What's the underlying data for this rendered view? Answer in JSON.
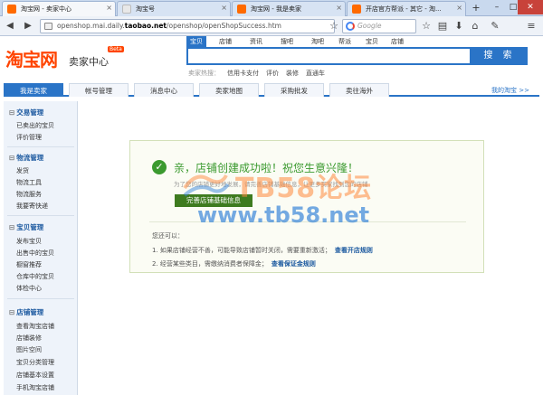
{
  "browser": {
    "tabs": [
      {
        "label": "淘宝网 - 卖家中心",
        "active": true
      },
      {
        "label": "淘宝号",
        "active": false
      },
      {
        "label": "淘宝网 - 我是卖家",
        "active": false
      },
      {
        "label": "开店官方帮派 - 其它 - 淘...",
        "active": false
      }
    ],
    "new_tab_label": "+",
    "url_prefix": "openshop.mai.daily.",
    "url_domain": "taobao.net",
    "url_suffix": "/openshop/openShopSuccess.htm",
    "search_placeholder": "Google"
  },
  "header": {
    "logo": "淘宝网",
    "logo_sub": "卖家中心",
    "badge": "Beta",
    "search_tabs": [
      "宝贝",
      "店铺",
      "资讯",
      "搜吧",
      "淘吧",
      "帮派",
      "宝贝",
      "店铺"
    ],
    "search_button": "搜 索",
    "hot_label": "卖家热搜：",
    "hot_links": [
      "信用卡支付",
      "评价",
      "装修",
      "直通车"
    ]
  },
  "mainnav": {
    "items": [
      "我是卖家",
      "帐号管理",
      "消息中心",
      "卖家地图",
      "采购批发",
      "卖往海外"
    ],
    "my_taobao": "我的淘宝 >>"
  },
  "sidebar": {
    "groups": [
      {
        "title": "交易管理",
        "items": [
          "已卖出的宝贝",
          "评价管理"
        ]
      },
      {
        "title": "物流管理",
        "items": [
          "发货",
          "物流工具",
          "物流服务",
          "我要寄快递"
        ]
      },
      {
        "title": "宝贝管理",
        "items": [
          "发布宝贝",
          "出售中的宝贝",
          "橱窗推荐",
          "仓库中的宝贝",
          "体检中心"
        ]
      },
      {
        "title": "店铺管理",
        "items": [
          "查看淘宝店铺",
          "店铺装修",
          "图片空间",
          "宝贝分类管理",
          "店铺基本设置",
          "手机淘宝店铺"
        ]
      }
    ]
  },
  "success": {
    "title": "亲，店铺创建成功啦！祝您生意兴隆！",
    "subtext": "为了您的店铺更好地发展，请完善店铺基础信息，让更多买家找到您的店铺",
    "button": "完善店铺基础信息",
    "note_head": "您还可以：",
    "notes": [
      {
        "text": "1. 如果店铺经营不善，可能导致店铺暂时关闭，需要重新激活；",
        "link": "查看开店规则"
      },
      {
        "text": "2. 经营某些类目，需缴纳消费者保障金；",
        "link": "查看保证金规则"
      }
    ]
  },
  "watermark": {
    "text": "TB58论坛",
    "url": "www.tb58.net"
  },
  "colors": {
    "taobao_orange": "#ff4400",
    "nav_blue": "#2a74c7",
    "success_green": "#3b9a2f"
  }
}
